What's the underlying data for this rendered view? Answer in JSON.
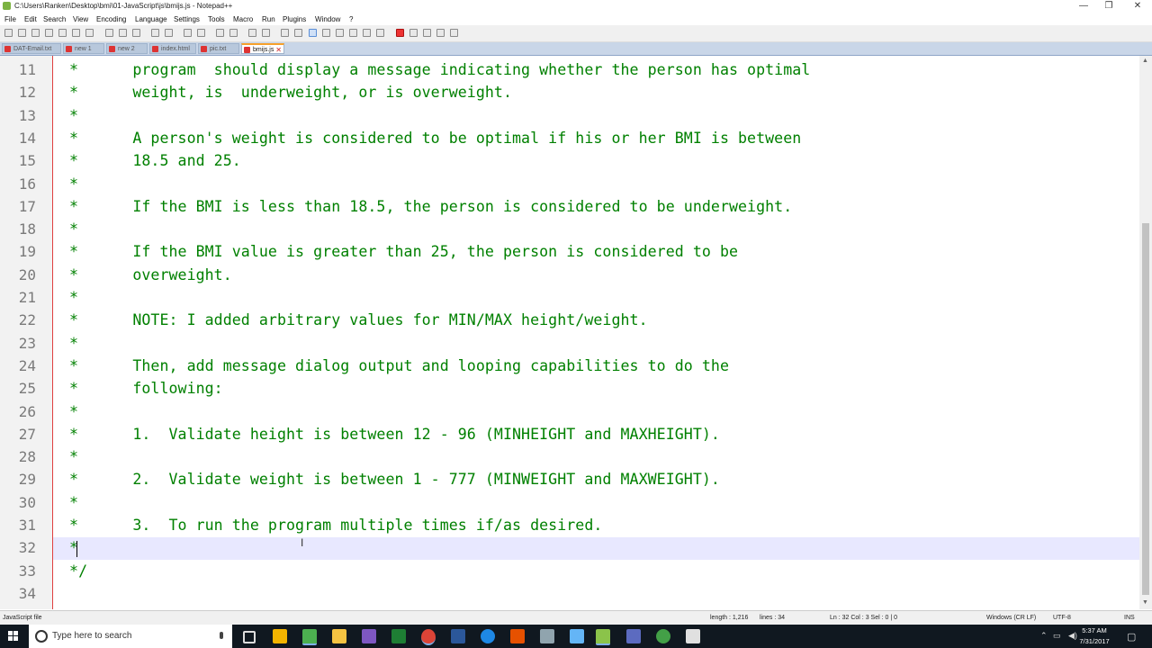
{
  "window": {
    "title": "C:\\Users\\Ranken\\Desktop\\bmi\\01-JavaScript\\js\\bmijs.js - Notepad++",
    "minimize": "—",
    "restore": "❐",
    "close": "✕"
  },
  "menu": [
    "File",
    "Edit",
    "Search",
    "View",
    "Encoding",
    "Language",
    "Settings",
    "Tools",
    "Macro",
    "Run",
    "Plugins",
    "Window",
    "?"
  ],
  "tabs": [
    {
      "label": "DAT-Email.txt",
      "active": false
    },
    {
      "label": "new 1",
      "active": false
    },
    {
      "label": "new 2",
      "active": false
    },
    {
      "label": "index.html",
      "active": false
    },
    {
      "label": "pic.txt",
      "active": false
    },
    {
      "label": "bmijs.js",
      "active": true
    }
  ],
  "editor": {
    "lines": [
      {
        "n": "11",
        "text": " *      program  should display a message indicating whether the person has optimal"
      },
      {
        "n": "12",
        "text": " *      weight, is  underweight, or is overweight."
      },
      {
        "n": "13",
        "text": " *"
      },
      {
        "n": "14",
        "text": " *      A person's weight is considered to be optimal if his or her BMI is between"
      },
      {
        "n": "15",
        "text": " *      18.5 and 25."
      },
      {
        "n": "16",
        "text": " *"
      },
      {
        "n": "17",
        "text": " *      If the BMI is less than 18.5, the person is considered to be underweight."
      },
      {
        "n": "18",
        "text": " *"
      },
      {
        "n": "19",
        "text": " *      If the BMI value is greater than 25, the person is considered to be"
      },
      {
        "n": "20",
        "text": " *      overweight."
      },
      {
        "n": "21",
        "text": " *"
      },
      {
        "n": "22",
        "text": " *      NOTE: I added arbitrary values for MIN/MAX height/weight."
      },
      {
        "n": "23",
        "text": " *"
      },
      {
        "n": "24",
        "text": " *      Then, add message dialog output and looping capabilities to do the"
      },
      {
        "n": "25",
        "text": " *      following:"
      },
      {
        "n": "26",
        "text": " *"
      },
      {
        "n": "27",
        "text": " *      1.  Validate height is between 12 - 96 (MINHEIGHT and MAXHEIGHT)."
      },
      {
        "n": "28",
        "text": " *"
      },
      {
        "n": "29",
        "text": " *      2.  Validate weight is between 1 - 777 (MINWEIGHT and MAXWEIGHT)."
      },
      {
        "n": "30",
        "text": " *"
      },
      {
        "n": "31",
        "text": " *      3.  To run the program multiple times if/as desired."
      },
      {
        "n": "32",
        "text": " *"
      },
      {
        "n": "33",
        "text": " */"
      },
      {
        "n": "34",
        "text": ""
      }
    ],
    "current_line": "32"
  },
  "status": {
    "filetype": "JavaScript file",
    "length": "length : 1,216",
    "lines": "lines : 34",
    "position": "Ln : 32   Col : 3   Sel : 0 | 0",
    "eol": "Windows (CR LF)",
    "encoding": "UTF-8",
    "mode": "INS"
  },
  "taskbar": {
    "search_placeholder": "Type here to search",
    "time": "5:37 AM",
    "date": "7/31/2017"
  }
}
